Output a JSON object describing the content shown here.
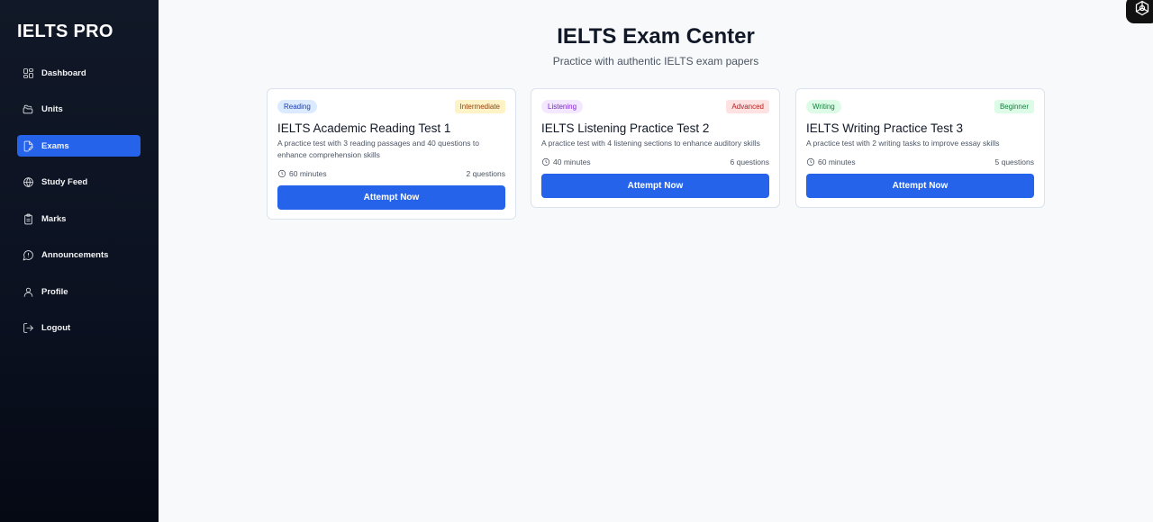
{
  "sidebar": {
    "brand": "IELTS PRO",
    "items": [
      {
        "label": "Dashboard",
        "icon": "dashboard-icon"
      },
      {
        "label": "Units",
        "icon": "folders-icon"
      },
      {
        "label": "Exams",
        "icon": "file-pen-icon",
        "active": true
      },
      {
        "label": "Study Feed",
        "icon": "globe-icon"
      },
      {
        "label": "Marks",
        "icon": "clipboard-icon"
      },
      {
        "label": "Announcements",
        "icon": "message-circle-icon"
      },
      {
        "label": "Profile",
        "icon": "user-icon"
      },
      {
        "label": "Logout",
        "icon": "logout-icon"
      }
    ]
  },
  "page": {
    "title": "IELTS Exam Center",
    "subtitle": "Practice with authentic IELTS exam papers"
  },
  "exams": [
    {
      "category": "Reading",
      "level": "Intermediate",
      "title": "IELTS Academic Reading Test 1",
      "description": "A practice test with 3 reading passages and 40 questions to enhance comprehension skills",
      "duration": "60 minutes",
      "questions": "2 questions",
      "button": "Attempt Now",
      "category_colors": {
        "bg": "#dbeafe",
        "fg": "#1e40af"
      },
      "level_colors": {
        "bg": "#fef3c7",
        "fg": "#92400e"
      }
    },
    {
      "category": "Listening",
      "level": "Advanced",
      "title": "IELTS Listening Practice Test 2",
      "description": "A practice test with 4 listening sections to enhance auditory skills",
      "duration": "40 minutes",
      "questions": "6 questions",
      "button": "Attempt Now",
      "category_colors": {
        "bg": "#f3e8ff",
        "fg": "#7e22ce"
      },
      "level_colors": {
        "bg": "#fee2e2",
        "fg": "#b91c1c"
      }
    },
    {
      "category": "Writing",
      "level": "Beginner",
      "title": "IELTS Writing Practice Test 3",
      "description": "A practice test with 2 writing tasks to improve essay skills",
      "duration": "60 minutes",
      "questions": "5 questions",
      "button": "Attempt Now",
      "category_colors": {
        "bg": "#dcfce7",
        "fg": "#15803d"
      },
      "level_colors": {
        "bg": "#dcfce7",
        "fg": "#15803d"
      }
    }
  ],
  "colors": {
    "accent": "#2563eb",
    "sidebar_bg": "#0b1120",
    "page_bg": "#f8f9fb"
  }
}
